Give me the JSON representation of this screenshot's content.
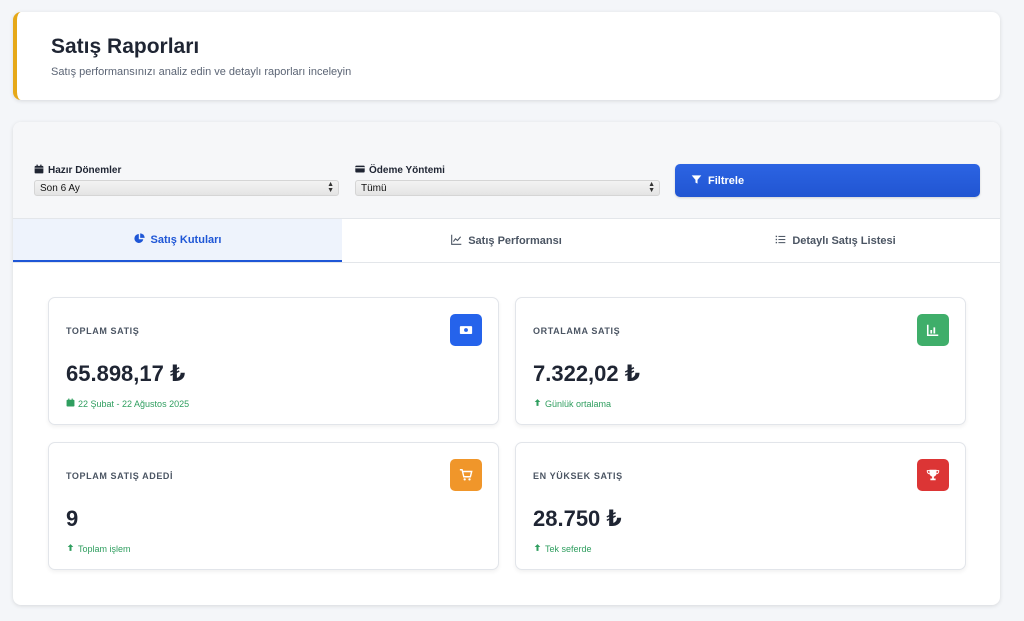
{
  "header": {
    "title": "Satış Raporları",
    "subtitle": "Satış performansınızı analiz edin ve detaylı raporları inceleyin",
    "accent_color": "#e6a817"
  },
  "filters": {
    "period": {
      "label": "Hazır Dönemler",
      "value": "Son 6 Ay",
      "icon": "calendar-icon"
    },
    "payment": {
      "label": "Ödeme Yöntemi",
      "value": "Tümü",
      "icon": "credit-card-icon"
    },
    "button_label": "Filtrele",
    "button_icon": "filter-icon",
    "button_color": "#2155d2"
  },
  "tabs": [
    {
      "label": "Satış Kutuları",
      "icon": "pie-chart-icon",
      "active": true
    },
    {
      "label": "Satış Performansı",
      "icon": "line-chart-icon",
      "active": false
    },
    {
      "label": "Detaylı Satış Listesi",
      "icon": "list-icon",
      "active": false
    }
  ],
  "stats": [
    {
      "label": "TOPLAM SATIŞ",
      "value": "65.898,17 ₺",
      "note": "22 Şubat - 22 Ağustos 2025",
      "note_icon": "calendar-icon",
      "icon": "money-icon",
      "color": "#2563eb"
    },
    {
      "label": "ORTALAMA SATIŞ",
      "value": "7.322,02 ₺",
      "note": "Günlük ortalama",
      "note_icon": "arrow-up-icon",
      "icon": "chart-icon",
      "color": "#3fae6a"
    },
    {
      "label": "TOPLAM SATIŞ ADEDİ",
      "value": "9",
      "note": "Toplam işlem",
      "note_icon": "arrow-up-icon",
      "icon": "cart-icon",
      "color": "#f0962a"
    },
    {
      "label": "EN YÜKSEK SATIŞ",
      "value": "28.750 ₺",
      "note": "Tek seferde",
      "note_icon": "arrow-up-icon",
      "icon": "trophy-icon",
      "color": "#dc3535"
    }
  ]
}
